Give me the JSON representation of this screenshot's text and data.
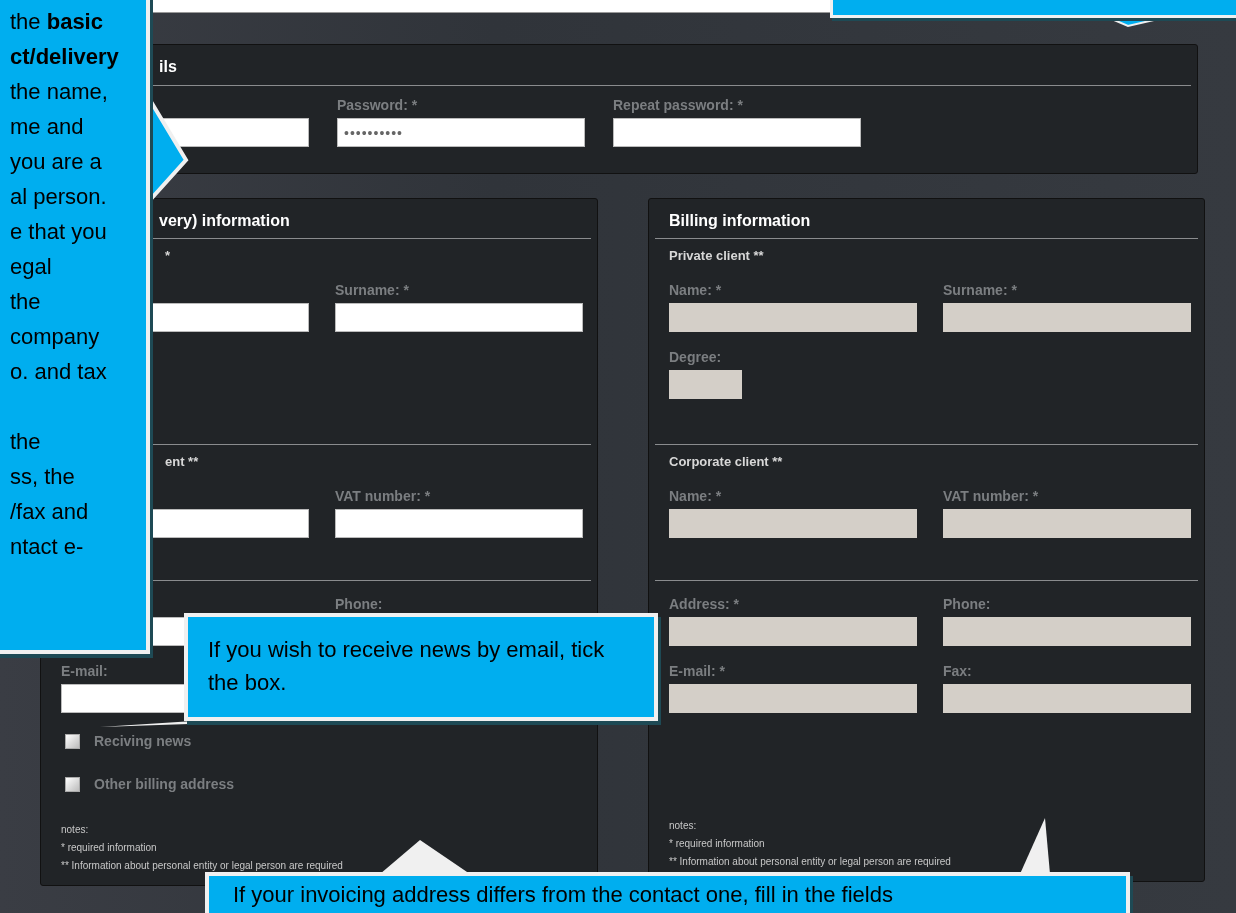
{
  "side_callout": {
    "paragraphs": [
      "the **basic**\n**ct/delivery**\nthe name,\nme and\nyou are a\nal person.\ne that you\negal\nthe\ncompany\no. and tax",
      "the\nss, the\n/fax and\nntact e-"
    ]
  },
  "account": {
    "title": "ils",
    "fields": [
      {
        "kind": "wide"
      },
      {
        "kind": "wide",
        "label": "Password: *",
        "value": "••••••••••"
      },
      {
        "kind": "wide",
        "label": "Repeat password: *"
      }
    ]
  },
  "contact": {
    "title": "very) information",
    "sections": [
      {
        "subtitle": "*",
        "rows": [
          [
            {
              "kind": "wide",
              "disabled": false
            },
            {
              "kind": "wide",
              "label": "Surname: *",
              "disabled": false
            }
          ]
        ]
      },
      {
        "subtitle": "ent **",
        "rows": [
          [
            {
              "kind": "wide",
              "disabled": false
            },
            {
              "kind": "wide",
              "label": "VAT number: *",
              "disabled": false
            }
          ]
        ]
      },
      {
        "rows": [
          [
            {
              "kind": "wide",
              "disabled": false
            },
            {
              "kind": "caption",
              "label": "Phone:"
            }
          ],
          [
            {
              "kind": "full",
              "label": "E-mail:",
              "disabled": false
            }
          ]
        ]
      }
    ],
    "checkboxes": [
      {
        "label": "Reciving news",
        "checked": false
      },
      {
        "label": "Other billing address",
        "checked": false
      }
    ],
    "notes": [
      "notes:",
      "* required information",
      "** Information about personal entity or legal person are required"
    ]
  },
  "billing": {
    "title": "Billing information",
    "sections": [
      {
        "subtitle": "Private client **",
        "rows": [
          [
            {
              "kind": "wide",
              "label": "Name: *",
              "disabled": true
            },
            {
              "kind": "wide",
              "label": "Surname: *",
              "disabled": true
            }
          ],
          [
            {
              "kind": "short",
              "label": "Degree:",
              "disabled": true
            }
          ]
        ]
      },
      {
        "subtitle": "Corporate client **",
        "rows": [
          [
            {
              "kind": "wide",
              "label": "Name: *",
              "disabled": true
            },
            {
              "kind": "wide",
              "label": "VAT number: *",
              "disabled": true
            }
          ]
        ]
      },
      {
        "rows": [
          [
            {
              "kind": "wide",
              "label": "Address: *",
              "disabled": true
            },
            {
              "kind": "wide",
              "label": "Phone:",
              "disabled": true
            }
          ],
          [
            {
              "kind": "wide",
              "label": "E-mail: *",
              "disabled": true
            },
            {
              "kind": "wide",
              "label": "Fax:",
              "disabled": true
            }
          ]
        ]
      }
    ],
    "notes": [
      "notes:",
      "* required information",
      "** Information about personal entity or legal person are required"
    ]
  },
  "news_callout": {
    "text": "If you wish to receive news by email, tick the box."
  },
  "bottom_callout": {
    "text": "If your invoicing address differs from the contact one, fill in the fields"
  }
}
